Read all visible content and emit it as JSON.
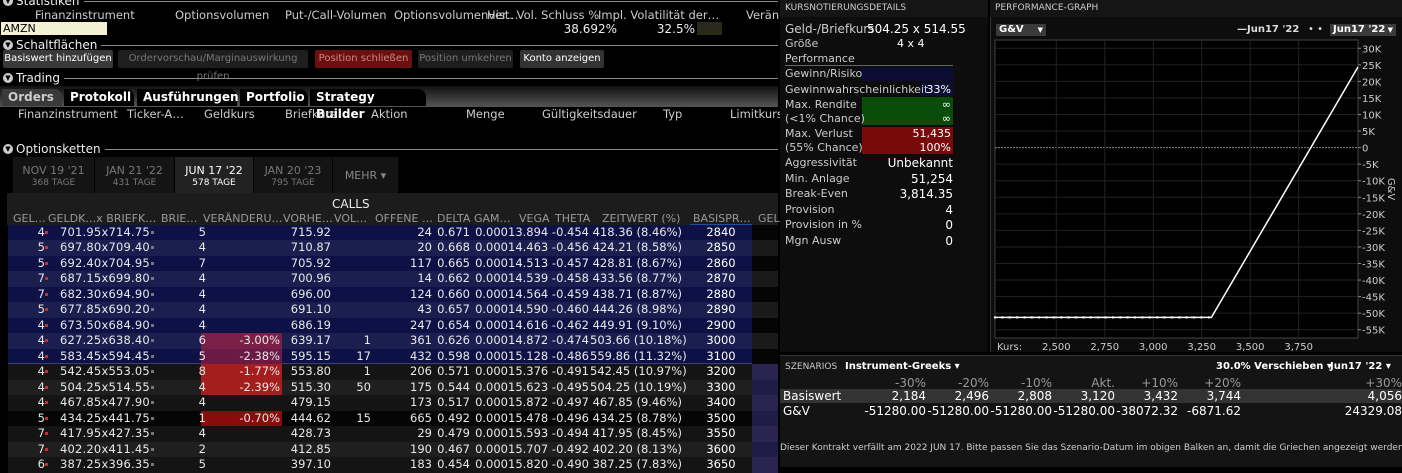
{
  "statistics": {
    "section": "Statistiken",
    "columns": [
      "Finanzinstrument",
      "Optionsvolumen",
      "Put-/Call-Volumen",
      "Optionsvolumenver…",
      "Hist. Vol. Schluss %",
      "Impl. Volatilität der…",
      "Verän"
    ],
    "symbol": "AMZN",
    "hist_vol": "38.692%",
    "impl_vol": "32.5%"
  },
  "buttons": {
    "section": "Schaltflächen",
    "add": "Basiswert hinzufügen",
    "preview": "Ordervorschau/Marginauswirkung prüfen",
    "close": "Position schließen",
    "reverse": "Position umkehren",
    "account": "Konto anzeigen"
  },
  "trading": {
    "section": "Trading",
    "tabs": [
      "Orders",
      "Protokoll",
      "Ausführungen",
      "Portfolio",
      "Strategy Builder"
    ],
    "columns": [
      "Finanzinstrument",
      "Ticker-A…",
      "Geldkurs",
      "Briefkurs",
      "Aktion",
      "Menge",
      "Gültigkeitsdauer",
      "Typ",
      "Limitkurs"
    ]
  },
  "chain": {
    "section": "Optionsketten",
    "expiries": [
      {
        "date": "NOV 19 '21",
        "days": "368 TAGE"
      },
      {
        "date": "JAN 21 '22",
        "days": "431 TAGE"
      },
      {
        "date": "JUN 17 '22",
        "days": "578 TAGE"
      },
      {
        "date": "JAN 20 '23",
        "days": "795 TAGE"
      }
    ],
    "more": "MEHR ▾",
    "calls_label": "CALLS",
    "headers": [
      "GEL…",
      "GELDK…x BRIEFK…",
      "BRIE…",
      "VERÄNDERU…",
      "VORHE…",
      "VOL…",
      "OFFENE …",
      "DELTA",
      "GAM…",
      "VEGA",
      "THETA",
      "ZEITWERT (%)",
      "BASISPR…",
      "GEL"
    ],
    "rows": [
      [
        "4",
        "701.95x714.75",
        "5",
        "",
        "715.92",
        "",
        "24",
        "0.671",
        "0.000",
        "13.894",
        "-0.454",
        "418.36 (8.46%)",
        "2840"
      ],
      [
        "5",
        "697.80x709.40",
        "4",
        "",
        "710.87",
        "",
        "20",
        "0.668",
        "0.000",
        "14.463",
        "-0.456",
        "424.21 (8.58%)",
        "2850"
      ],
      [
        "5",
        "692.40x704.95",
        "7",
        "",
        "705.92",
        "",
        "117",
        "0.665",
        "0.000",
        "14.513",
        "-0.457",
        "428.81 (8.67%)",
        "2860"
      ],
      [
        "7",
        "687.15x699.80",
        "4",
        "",
        "700.96",
        "",
        "14",
        "0.662",
        "0.000",
        "14.539",
        "-0.458",
        "433.56 (8.77%)",
        "2870"
      ],
      [
        "7",
        "682.30x694.90",
        "4",
        "",
        "696.00",
        "",
        "124",
        "0.660",
        "0.000",
        "14.564",
        "-0.459",
        "438.71 (8.87%)",
        "2880"
      ],
      [
        "5",
        "677.85x690.20",
        "4",
        "",
        "691.10",
        "",
        "43",
        "0.657",
        "0.000",
        "14.590",
        "-0.460",
        "444.26 (8.98%)",
        "2890"
      ],
      [
        "4",
        "673.50x684.90",
        "4",
        "",
        "686.19",
        "",
        "247",
        "0.654",
        "0.000",
        "14.616",
        "-0.462",
        "449.91 (9.10%)",
        "2900"
      ],
      [
        "4",
        "627.25x638.40",
        "6",
        "-3.00%",
        "639.17",
        "1",
        "361",
        "0.626",
        "0.000",
        "14.872",
        "-0.474",
        "503.66 (10.18%)",
        "3000"
      ],
      [
        "4",
        "583.45x594.45",
        "5",
        "-2.38%",
        "595.15",
        "17",
        "432",
        "0.598",
        "0.000",
        "15.128",
        "-0.486",
        "559.86 (11.32%)",
        "3100"
      ],
      [
        "4",
        "542.45x553.05",
        "8",
        "-1.77%",
        "553.80",
        "1",
        "206",
        "0.571",
        "0.000",
        "15.376",
        "-0.491",
        "542.45 (10.97%)",
        "3200"
      ],
      [
        "4",
        "504.25x514.55",
        "4",
        "-2.39%",
        "515.30",
        "50",
        "175",
        "0.544",
        "0.000",
        "15.623",
        "-0.495",
        "504.25 (10.19%)",
        "3300"
      ],
      [
        "4",
        "467.85x477.90",
        "4",
        "",
        "479.15",
        "",
        "173",
        "0.517",
        "0.000",
        "15.872",
        "-0.497",
        "467.85 (9.46%)",
        "3400"
      ],
      [
        "5",
        "434.25x441.75",
        "1",
        "-0.70%",
        "444.62",
        "15",
        "665",
        "0.492",
        "0.000",
        "15.478",
        "-0.496",
        "434.25 (8.78%)",
        "3500"
      ],
      [
        "7",
        "417.95x427.35",
        "4",
        "",
        "428.73",
        "",
        "29",
        "0.479",
        "0.000",
        "15.593",
        "-0.494",
        "417.95 (8.45%)",
        "3550"
      ],
      [
        "7",
        "402.20x411.45",
        "2",
        "",
        "412.85",
        "",
        "190",
        "0.467",
        "0.000",
        "15.707",
        "-0.492",
        "402.20 (8.13%)",
        "3600"
      ],
      [
        "6",
        "387.25x396.35",
        "5",
        "",
        "397.10",
        "",
        "183",
        "0.454",
        "0.000",
        "15.820",
        "-0.490",
        "387.25 (7.83%)",
        "3650"
      ]
    ]
  },
  "quote": {
    "title": "KURSNOTIERUNGSDETAILS",
    "bidask_label": "Geld-/Briefkurs",
    "bidask": "504.25 x 514.55",
    "size_label": "Größe",
    "size": "4 x 4",
    "performance": "Performance",
    "gain_risk": "Gewinn/Risiko",
    "win_prob_label": "Gewinnwahrscheinlichkeit",
    "win_prob": "33%",
    "max_return": "Max. Rendite",
    "max_return_chance": "(<1% Chance)",
    "inf": "∞",
    "max_loss": "Max. Verlust",
    "max_loss_val": "51,435",
    "max_loss_chance": "(55% Chance)",
    "max_loss_pct": "100%",
    "aggr_label": "Aggressivität",
    "aggr": "Unbekannt",
    "min_inv_label": "Min. Anlage",
    "min_inv": "51,254",
    "be_label": "Break-Even",
    "be": "3,814.35",
    "comm_label": "Provision",
    "comm": "4",
    "comm_pct_label": "Provision in %",
    "comm_pct": "0",
    "mgn_label": "Mgn Ausw",
    "mgn": "0"
  },
  "graph": {
    "title": "PERFORMANCE-GRAPH",
    "select": "G&V",
    "legend": "Jun17 '22",
    "date_select": "Jun17 '22",
    "kurs_label": "Kurs:"
  },
  "chart_data": {
    "type": "line",
    "title": "PERFORMANCE-GRAPH",
    "xlabel": "Kurs",
    "ylabel": "G&V",
    "xlim": [
      2184,
      4056
    ],
    "ylim": [
      -57500,
      32500
    ],
    "xticks": [
      2500,
      2750,
      3000,
      3250,
      3500,
      3750
    ],
    "xtick_labels": [
      "2,500",
      "2,750",
      "3,000",
      "3,250",
      "3,500",
      "3,750"
    ],
    "yticks": [
      30000,
      25000,
      20000,
      15000,
      10000,
      5000,
      0,
      -5000,
      -10000,
      -15000,
      -20000,
      -25000,
      -30000,
      -35000,
      -40000,
      -45000,
      -50000,
      -55000
    ],
    "ytick_labels": [
      "30K",
      "25K",
      "20K",
      "15K",
      "10K",
      "5K",
      "0",
      "-5K",
      "-10K",
      "-15K",
      "-20K",
      "-25K",
      "-30K",
      "-35K",
      "-40K",
      "-45K",
      "-50K",
      "-55K"
    ],
    "series": [
      {
        "name": "Jun17 '22",
        "x": [
          2184,
          3300,
          4056
        ],
        "y": [
          -51280,
          -51280,
          24329.08
        ]
      }
    ],
    "grid": true
  },
  "scenarios": {
    "title": "SZENARIOS",
    "mode": "Instrument-Greeks ▾",
    "shift": "30.0% Verschieben ▾",
    "date": "Jun17 '22 ▾",
    "columns": [
      "-30%",
      "-20%",
      "-10%",
      "Akt.",
      "+10%",
      "+20%",
      "+30%"
    ],
    "underlying_label": "Basiswert",
    "underlying": [
      "2,184",
      "2,496",
      "2,808",
      "3,120",
      "3,432",
      "3,744",
      "4,056"
    ],
    "pnl_label": "G&V",
    "pnl": [
      "-51280.00",
      "-51280.00",
      "-51280.00",
      "-51280.00",
      "-38072.32",
      "-6871.62",
      "24329.08"
    ],
    "note": "Dieser Kontrakt verfällt am 2022 JUN 17. Bitte passen Sie das Szenario-Datum im obigen Balken an, damit die Griechen angezeigt werden."
  },
  "colors": {
    "navy": "#10134a",
    "strike": "#1f4fa3",
    "red": "#a01e1e",
    "green": "#0a4d0a"
  }
}
